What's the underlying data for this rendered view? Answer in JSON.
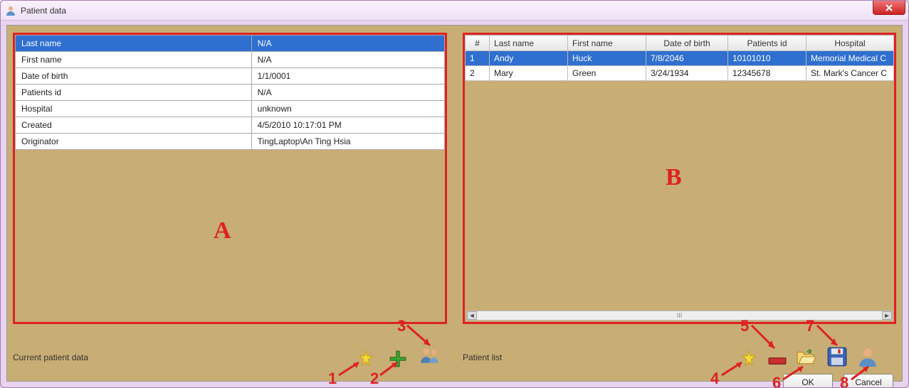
{
  "window": {
    "title": "Patient data"
  },
  "left": {
    "caption": "Current patient data",
    "rows": [
      {
        "key": "Last name",
        "value": "N/A",
        "selected": true
      },
      {
        "key": "First name",
        "value": "N/A",
        "selected": false
      },
      {
        "key": "Date of birth",
        "value": "1/1/0001",
        "selected": false
      },
      {
        "key": "Patients id",
        "value": "N/A",
        "selected": false
      },
      {
        "key": "Hospital",
        "value": "unknown",
        "selected": false
      },
      {
        "key": "Created",
        "value": "4/5/2010 10:17:01 PM",
        "selected": false
      },
      {
        "key": "Originator",
        "value": "TingLaptop\\An Ting Hsia",
        "selected": false
      }
    ]
  },
  "right": {
    "caption": "Patient list",
    "columns": [
      "#",
      "Last name",
      "First name",
      "Date of birth",
      "Patients id",
      "Hospital"
    ],
    "rows": [
      {
        "n": "1",
        "last": "Andy",
        "first": "Huck",
        "dob": "7/8/2046",
        "pid": "10101010",
        "hospital": "Memorial Medical C",
        "selected": true
      },
      {
        "n": "2",
        "last": "Mary",
        "first": "Green",
        "dob": "3/24/1934",
        "pid": "12345678",
        "hospital": "St. Mark's Cancer C",
        "selected": false
      }
    ]
  },
  "buttons": {
    "ok": "OK",
    "cancel": "Cancel"
  },
  "overlay": {
    "a": "A",
    "b": "B",
    "nums": [
      "1",
      "2",
      "3",
      "4",
      "5",
      "6",
      "7",
      "8"
    ]
  },
  "scroll": {
    "thumb_label": "III"
  }
}
